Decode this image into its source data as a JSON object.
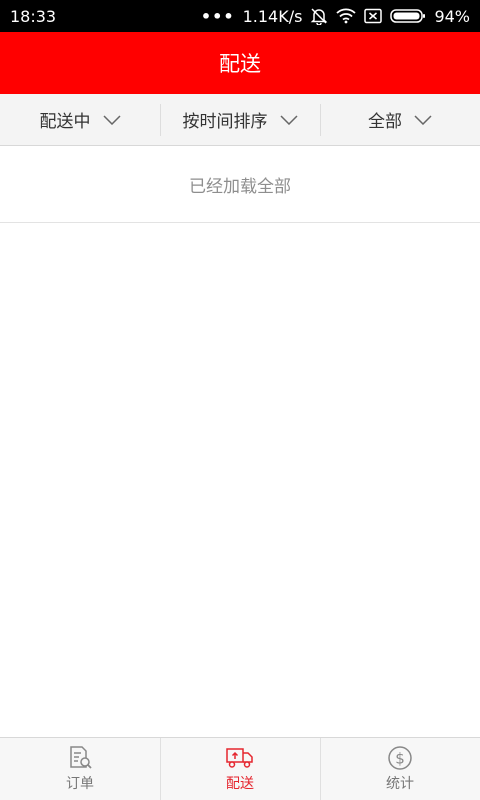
{
  "status_bar": {
    "time": "18:33",
    "network_speed": "1.14K/s",
    "battery": "94%",
    "icons": [
      "signal-dots-icon",
      "notification-mute-icon",
      "wifi-icon",
      "sim-error-icon",
      "battery-icon"
    ]
  },
  "header": {
    "title": "配送"
  },
  "filters": [
    {
      "label": "配送中",
      "icon": "chevron-down-icon"
    },
    {
      "label": "按时间排序",
      "icon": "chevron-down-icon"
    },
    {
      "label": "全部",
      "icon": "chevron-down-icon"
    }
  ],
  "list": {
    "end_message": "已经加载全部"
  },
  "tabs": [
    {
      "label": "订单",
      "icon": "order-search-icon",
      "active": false
    },
    {
      "label": "配送",
      "icon": "delivery-truck-icon",
      "active": true
    },
    {
      "label": "统计",
      "icon": "dollar-circle-icon",
      "active": false
    }
  ],
  "colors": {
    "brand": "#ff0000",
    "active_tab": "#e5262f",
    "inactive_tab": "#777777"
  }
}
